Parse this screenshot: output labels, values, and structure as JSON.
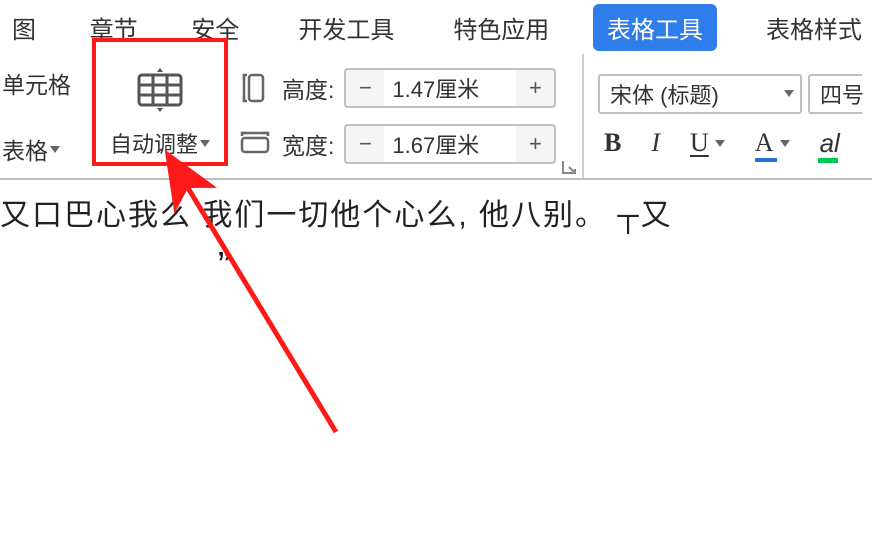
{
  "tabs": {
    "view": "图",
    "chapter": "章节",
    "security": "安全",
    "dev_tools": "开发工具",
    "special_apps": "特色应用",
    "table_tools": "表格工具",
    "table_style": "表格样式"
  },
  "ribbon": {
    "left": {
      "cell_label": "单元格",
      "table_label": "表格"
    },
    "auto_adjust_label": "自动调整",
    "dim": {
      "height_label": "高度:",
      "height_value": "1.47厘米",
      "width_label": "宽度:",
      "width_value": "1.67厘米",
      "minus": "−",
      "plus": "+"
    },
    "font": {
      "family": "宋体 (标题)",
      "size": "四号",
      "bold": "B",
      "italic": "I",
      "underline": "U",
      "color_letter": "A",
      "highlight_letter": "al"
    }
  },
  "doc": {
    "partial_text": "又口巴心我么  我们一切他个心么,  他八别。   ┬又",
    "close_quote": "”"
  }
}
